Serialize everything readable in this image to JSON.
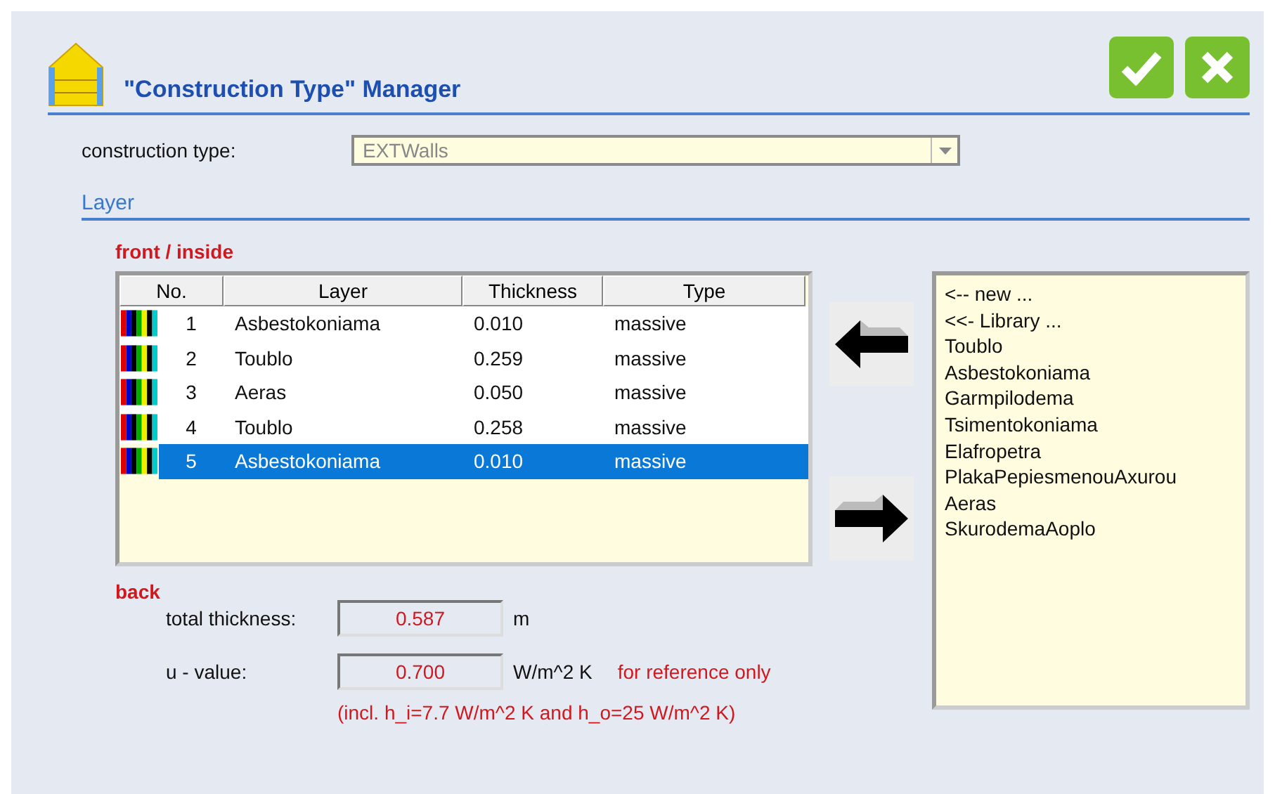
{
  "window": {
    "title": "\"Construction Type\" Manager"
  },
  "buttons": [
    {
      "kind": "ok"
    },
    {
      "kind": "cancel"
    }
  ],
  "construction_type": {
    "label": "construction type:",
    "value": "EXTWalls"
  },
  "section": {
    "title": "Layer"
  },
  "front_label": "front / inside",
  "back_label": "back",
  "table": {
    "columns": [
      "No.",
      "Layer",
      "Thickness",
      "Type"
    ],
    "rows": [
      {
        "no": "1",
        "layer": "Asbestokoniama",
        "thickness": "0.010",
        "type": "massive",
        "selected": false
      },
      {
        "no": "2",
        "layer": "Toublo",
        "thickness": "0.259",
        "type": "massive",
        "selected": false
      },
      {
        "no": "3",
        "layer": "Aeras",
        "thickness": "0.050",
        "type": "massive",
        "selected": false
      },
      {
        "no": "4",
        "layer": "Toublo",
        "thickness": "0.258",
        "type": "massive",
        "selected": false
      },
      {
        "no": "5",
        "layer": "Asbestokoniama",
        "thickness": "0.010",
        "type": "massive",
        "selected": true
      }
    ]
  },
  "move_buttons": [
    {
      "kind": "left"
    },
    {
      "kind": "right"
    }
  ],
  "library": [
    "<-- new ...",
    "<<- Library ...",
    "Toublo",
    "Asbestokoniama",
    "Garmpilodema",
    "Tsimentokoniama",
    "Elafropetra",
    "PlakaPepiesmenouAxurou",
    "Aeras",
    "SkurodemaAoplo"
  ],
  "results": [
    {
      "label": "total thickness:",
      "value": "0.587",
      "unit": "m"
    },
    {
      "label": "u - value:",
      "value": "0.700",
      "unit": "W/m^2 K",
      "note": "for reference only"
    }
  ],
  "footnote": "(incl. h_i=7.7 W/m^2 K and h_o=25 W/m^2 K)"
}
